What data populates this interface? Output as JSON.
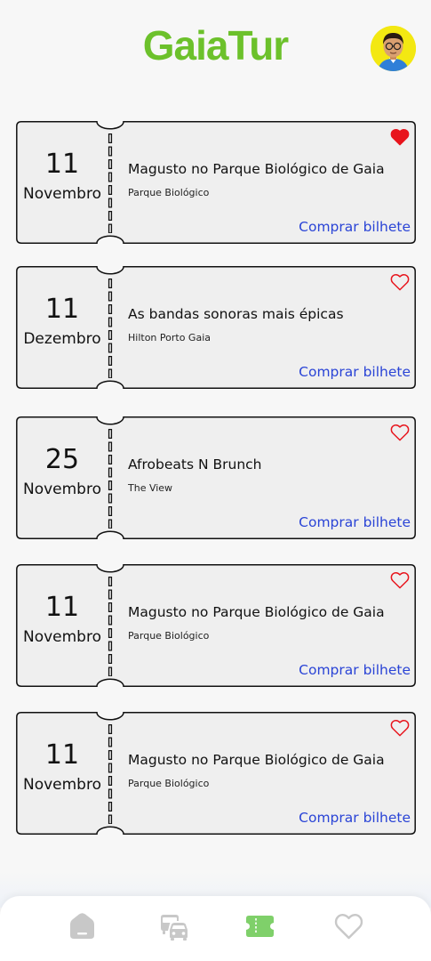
{
  "app": {
    "title": "GaiaTur"
  },
  "profile": {
    "avatar_icon": "user-avatar-icon"
  },
  "events": [
    {
      "day": "11",
      "month": "Novembro",
      "title": "Magusto no Parque Biológico de Gaia",
      "venue": "Parque Biológico",
      "action": "Comprar bilhete",
      "favorite": true
    },
    {
      "day": "11",
      "month": "Dezembro",
      "title": "As bandas sonoras mais épicas",
      "venue": "Hilton Porto Gaia",
      "action": "Comprar bilhete",
      "favorite": false
    },
    {
      "day": "25",
      "month": "Novembro",
      "title": "Afrobeats N Brunch",
      "venue": "The View",
      "action": "Comprar bilhete",
      "favorite": false
    },
    {
      "day": "11",
      "month": "Novembro",
      "title": "Magusto no Parque Biológico de Gaia",
      "venue": "Parque Biológico",
      "action": "Comprar bilhete",
      "favorite": false
    },
    {
      "day": "11",
      "month": "Novembro",
      "title": "Magusto no Parque Biológico de Gaia",
      "venue": "Parque Biológico",
      "action": "Comprar bilhete",
      "favorite": false
    }
  ],
  "nav": {
    "items": [
      "home-icon",
      "transport-icon",
      "tickets-icon",
      "favorites-icon"
    ],
    "active": "tickets-icon"
  },
  "colors": {
    "brand": "#6cc12b",
    "link": "#2a44d6",
    "heart": "#e8141c",
    "nav_inactive": "#c8c8c8",
    "nav_active": "#7fd06a"
  }
}
